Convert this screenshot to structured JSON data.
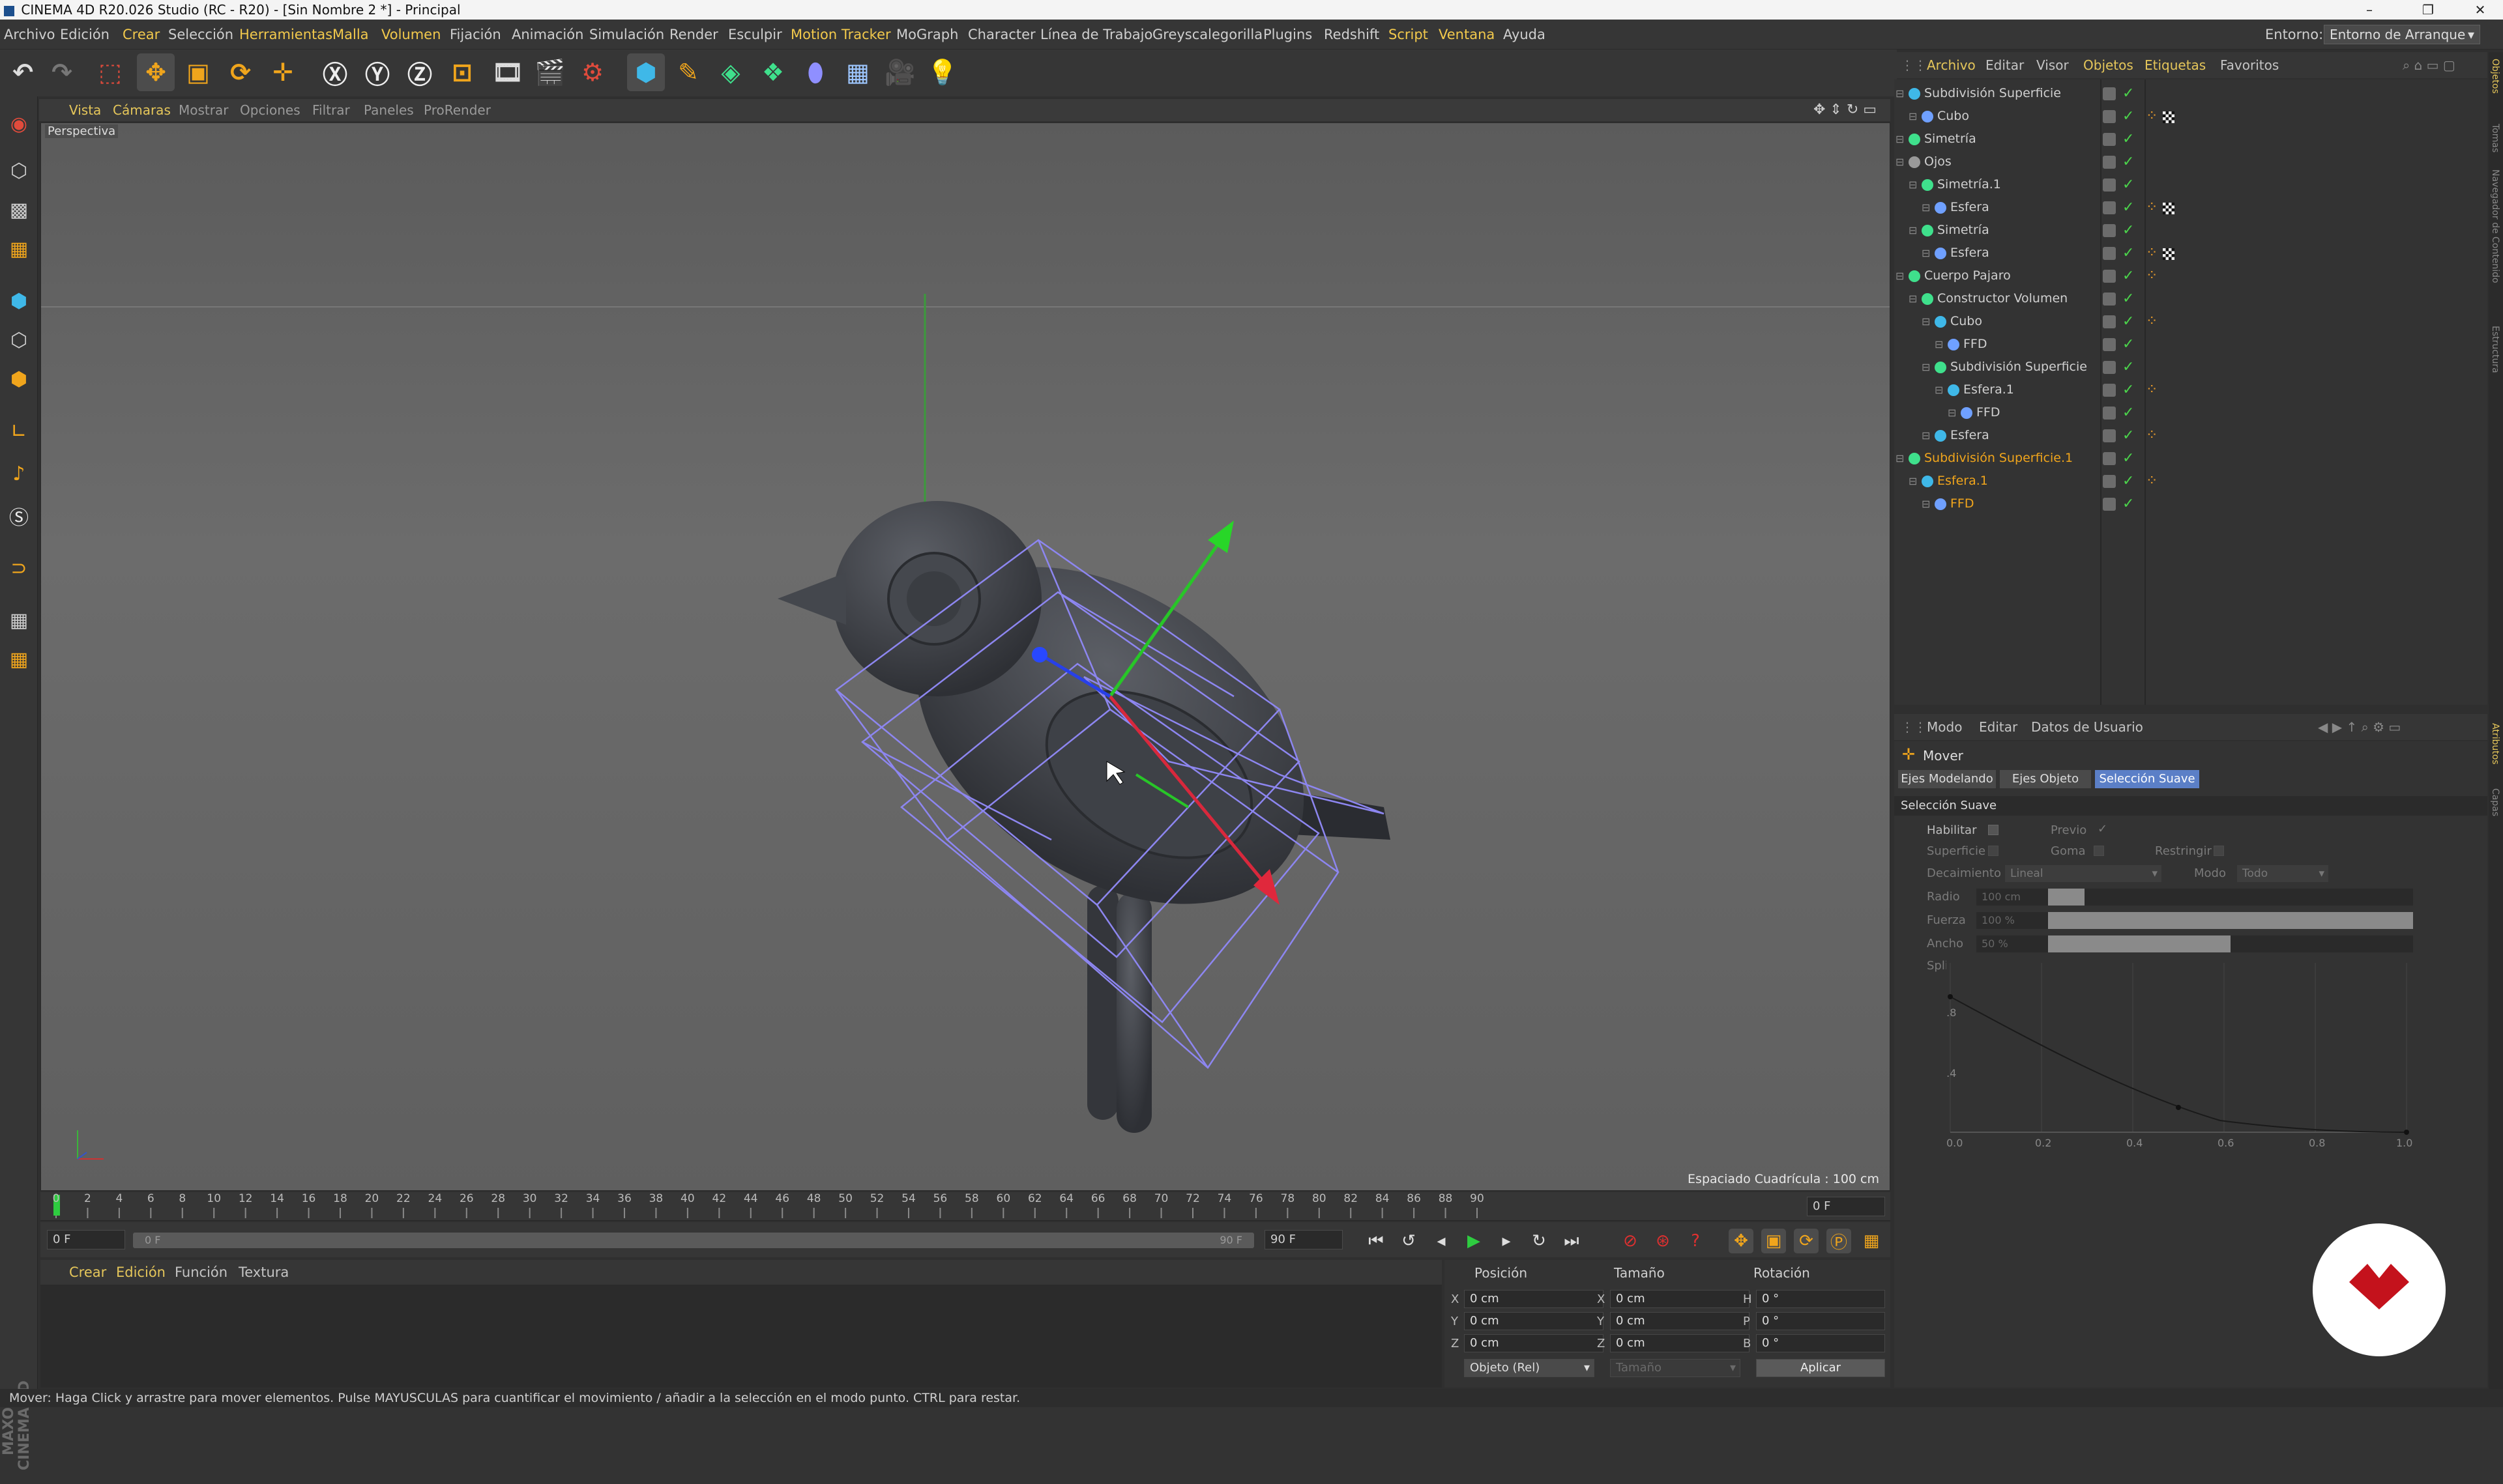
{
  "window": {
    "title": "CINEMA 4D R20.026 Studio (RC - R20) - [Sin Nombre 2 *] - Principal",
    "controls": [
      "–",
      "❐",
      "✕"
    ]
  },
  "menu": [
    "Archivo",
    "Edición",
    "Crear",
    "Selección",
    "Herramientas",
    "Malla",
    "Volumen",
    "Fijación",
    "Animación",
    "Simulación",
    "Render",
    "Esculpir",
    "Motion Tracker",
    "MoGraph",
    "Character",
    "Línea de Trabajo",
    "Greyscalegorilla",
    "Plugins",
    "Redshift",
    "Script",
    "Ventana",
    "Ayuda"
  ],
  "environment": {
    "label": "Entorno:",
    "value": "Entorno de Arranque"
  },
  "viewport": {
    "menu": [
      "Vista",
      "Cámaras",
      "Mostrar",
      "Opciones",
      "Filtrar",
      "Paneles",
      "ProRender"
    ],
    "label": "Perspectiva",
    "grid_spacing": "Espaciado Cuadrícula : 100 cm"
  },
  "timeline": {
    "ticks": [
      "0",
      "2",
      "4",
      "6",
      "8",
      "10",
      "12",
      "14",
      "16",
      "18",
      "20",
      "22",
      "24",
      "26",
      "28",
      "30",
      "32",
      "34",
      "36",
      "38",
      "40",
      "42",
      "44",
      "46",
      "48",
      "50",
      "52",
      "54",
      "56",
      "58",
      "60",
      "62",
      "64",
      "66",
      "68",
      "70",
      "72",
      "74",
      "76",
      "78",
      "80",
      "82",
      "84",
      "86",
      "88",
      "90"
    ],
    "current_frame": "0 F",
    "start": "0 F",
    "range_start": "0 F",
    "range_end": "90 F",
    "end": "90 F"
  },
  "material_manager": {
    "menu": [
      "Crear",
      "Edición",
      "Función",
      "Textura"
    ]
  },
  "coordinates": {
    "headers": [
      "Posición",
      "Tamaño",
      "Rotación"
    ],
    "rows": [
      {
        "axis": "X",
        "pos": "0 cm",
        "size_axis": "X",
        "size": "0 cm",
        "rot_axis": "H",
        "rot": "0 °"
      },
      {
        "axis": "Y",
        "pos": "0 cm",
        "size_axis": "Y",
        "size": "0 cm",
        "rot_axis": "P",
        "rot": "0 °"
      },
      {
        "axis": "Z",
        "pos": "0 cm",
        "size_axis": "Z",
        "size": "0 cm",
        "rot_axis": "B",
        "rot": "0 °"
      }
    ],
    "mode": "Objeto (Rel)",
    "size_mode": "Tamaño",
    "apply": "Aplicar"
  },
  "object_manager": {
    "tabs": [
      "Archivo",
      "Editar",
      "Visor",
      "Objetos",
      "Etiquetas",
      "Favoritos"
    ],
    "rows": [
      {
        "name": "Subdivisión Superficie",
        "indent": 0,
        "color": "#3fb8e8",
        "tag": "",
        "highlight": false
      },
      {
        "name": "Cubo",
        "indent": 1,
        "color": "#6fa0ff",
        "tag": "both",
        "highlight": false
      },
      {
        "name": "Simetría",
        "indent": 0,
        "color": "#3fe08c",
        "tag": "",
        "highlight": false
      },
      {
        "name": "Ojos",
        "indent": 0,
        "color": "#9a9a9a",
        "tag": "",
        "highlight": false
      },
      {
        "name": "Simetría.1",
        "indent": 1,
        "color": "#3fe08c",
        "tag": "",
        "highlight": false
      },
      {
        "name": "Esfera",
        "indent": 2,
        "color": "#6fa0ff",
        "tag": "both",
        "highlight": false
      },
      {
        "name": "Simetría",
        "indent": 1,
        "color": "#3fe08c",
        "tag": "",
        "highlight": false
      },
      {
        "name": "Esfera",
        "indent": 2,
        "color": "#6fa0ff",
        "tag": "both",
        "highlight": false
      },
      {
        "name": "Cuerpo Pajaro",
        "indent": 0,
        "color": "#3fe08c",
        "tag": "one",
        "highlight": false
      },
      {
        "name": "Constructor Volumen",
        "indent": 1,
        "color": "#3fe08c",
        "tag": "",
        "highlight": false
      },
      {
        "name": "Cubo",
        "indent": 2,
        "color": "#3fb8e8",
        "tag": "one",
        "highlight": false
      },
      {
        "name": "FFD",
        "indent": 3,
        "color": "#6fa0ff",
        "tag": "",
        "highlight": false
      },
      {
        "name": "Subdivisión Superficie",
        "indent": 2,
        "color": "#3fe08c",
        "tag": "",
        "highlight": false
      },
      {
        "name": "Esfera.1",
        "indent": 3,
        "color": "#3fb8e8",
        "tag": "one",
        "highlight": false
      },
      {
        "name": "FFD",
        "indent": 4,
        "color": "#6fa0ff",
        "tag": "",
        "highlight": false
      },
      {
        "name": "Esfera",
        "indent": 2,
        "color": "#3fb8e8",
        "tag": "one",
        "highlight": false
      },
      {
        "name": "Subdivisión Superficie.1",
        "indent": 0,
        "color": "#3fe08c",
        "tag": "",
        "highlight": true
      },
      {
        "name": "Esfera.1",
        "indent": 1,
        "color": "#3fb8e8",
        "tag": "one",
        "highlight": true
      },
      {
        "name": "FFD",
        "indent": 2,
        "color": "#6fa0ff",
        "tag": "",
        "highlight": true
      }
    ]
  },
  "attribute_manager": {
    "menu": [
      "Modo",
      "Editar",
      "Datos de Usuario"
    ],
    "tool": "Mover",
    "tabs": [
      "Ejes Modelando",
      "Ejes Objeto",
      "Selección Suave"
    ],
    "section": "Selección Suave",
    "habilitar": "Habilitar",
    "previo": "Previo",
    "superficie": "Superficie",
    "goma": "Goma",
    "restringir": "Restringir",
    "decaimiento_label": "Decaimiento",
    "decaimiento": "Lineal",
    "modo_label": "Modo",
    "modo": "Todo",
    "radio_label": "Radio",
    "radio": "100 cm",
    "fuerza_label": "Fuerza",
    "fuerza": "100 %",
    "ancho_label": "Ancho",
    "ancho": "50 %",
    "spline_label": "Spline",
    "spline_x_ticks": [
      "0.0",
      "0.2",
      "0.4",
      "0.6",
      "0.8",
      "1.0"
    ],
    "spline_y_ticks": [
      "0.8",
      "0.4"
    ],
    "slider_levels": {
      "radio": 0.1,
      "fuerza": 1.0,
      "ancho": 0.5
    }
  },
  "right_strip": [
    "Objetos",
    "Tomas",
    "Navegador de Contenido",
    "Estructura",
    "Atributos",
    "Capas"
  ],
  "status": "Mover: Haga Click y arrastre para mover elementos. Pulse MAYUSCULAS para cuantificar el movimiento / añadir a la selección en el modo punto. CTRL para restar."
}
